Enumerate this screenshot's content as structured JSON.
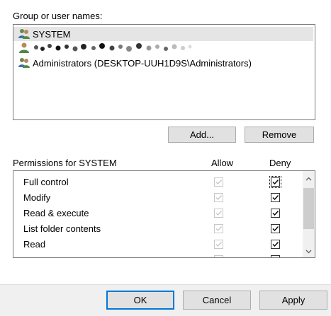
{
  "group_section": {
    "label": "Group or user names:",
    "items": [
      {
        "name": "SYSTEM",
        "icon": "users-icon",
        "selected": true
      },
      {
        "name": "",
        "icon": "user-icon",
        "obscured": true
      },
      {
        "name": "Administrators (DESKTOP-UUH1D9S\\Administrators)",
        "icon": "users-icon"
      }
    ]
  },
  "buttons": {
    "add": "Add...",
    "remove": "Remove"
  },
  "permissions": {
    "header_label": "Permissions for SYSTEM",
    "allow_header": "Allow",
    "deny_header": "Deny",
    "rows": [
      {
        "name": "Full control",
        "allow": true,
        "deny": true
      },
      {
        "name": "Modify",
        "allow": true,
        "deny": true
      },
      {
        "name": "Read & execute",
        "allow": true,
        "deny": true
      },
      {
        "name": "List folder contents",
        "allow": true,
        "deny": true
      },
      {
        "name": "Read",
        "allow": true,
        "deny": true
      }
    ]
  },
  "dialog_buttons": {
    "ok": "OK",
    "cancel": "Cancel",
    "apply": "Apply"
  },
  "colors": {
    "accent": "#0078d7",
    "disabled_check": "#c8c8c8",
    "selected_row": "#e5e5e5"
  }
}
